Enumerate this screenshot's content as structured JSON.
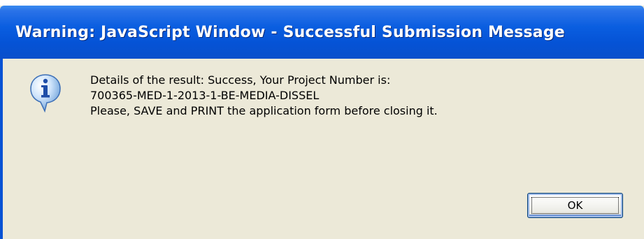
{
  "dialog": {
    "title": "Warning: JavaScript Window - Successful Submission Message",
    "icon": "info-icon",
    "message_lines": [
      "Details of the result: Success, Your Project Number is:",
      "700365-MED-1-2013-1-BE-MEDIA-DISSEL",
      "Please, SAVE and PRINT the application form before closing it."
    ],
    "ok_label": "OK"
  },
  "colors": {
    "titlebar": "#0553d6",
    "dialog_background": "#ece9d8",
    "title_text": "#ffffff"
  }
}
